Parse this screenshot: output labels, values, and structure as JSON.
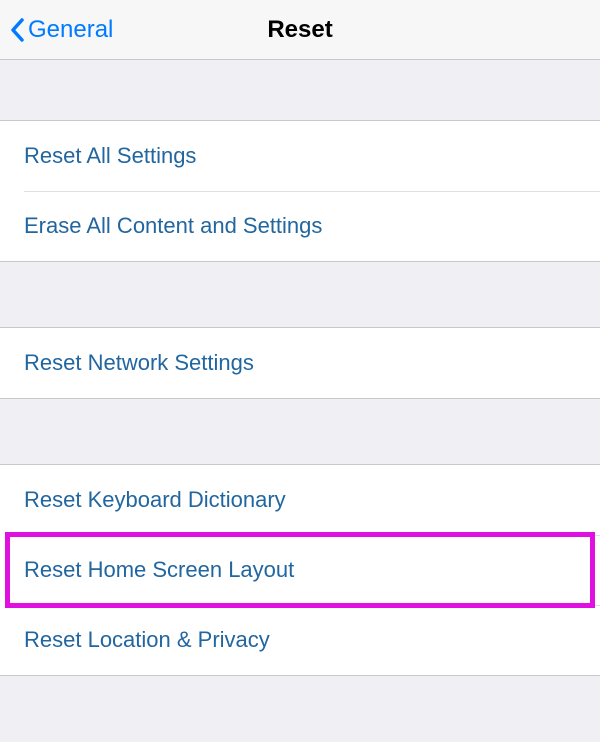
{
  "navbar": {
    "back_label": "General",
    "title": "Reset"
  },
  "groups": [
    {
      "rows": [
        {
          "label": "Reset All Settings"
        },
        {
          "label": "Erase All Content and Settings"
        }
      ]
    },
    {
      "rows": [
        {
          "label": "Reset Network Settings"
        }
      ]
    },
    {
      "rows": [
        {
          "label": "Reset Keyboard Dictionary"
        },
        {
          "label": "Reset Home Screen Layout",
          "highlighted": true
        },
        {
          "label": "Reset Location & Privacy"
        }
      ]
    }
  ]
}
